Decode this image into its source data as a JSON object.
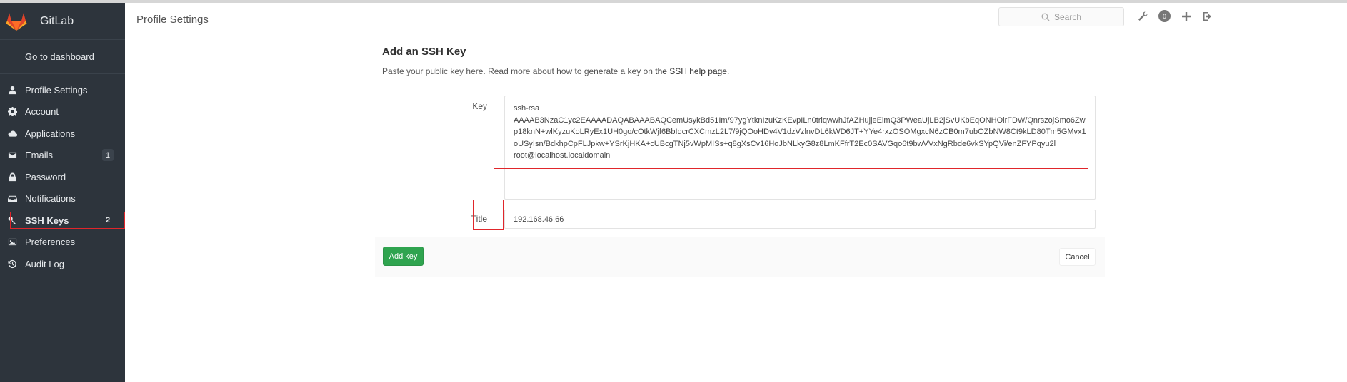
{
  "app": {
    "name": "GitLab"
  },
  "sidebar": {
    "goto": "Go to dashboard",
    "items": [
      {
        "label": "Profile Settings",
        "icon": "user-icon"
      },
      {
        "label": "Account",
        "icon": "gear-icon"
      },
      {
        "label": "Applications",
        "icon": "cloud-icon"
      },
      {
        "label": "Emails",
        "icon": "envelope-icon",
        "badge": "1"
      },
      {
        "label": "Password",
        "icon": "lock-icon"
      },
      {
        "label": "Notifications",
        "icon": "inbox-icon"
      },
      {
        "label": "SSH Keys",
        "icon": "key-icon",
        "badge": "2",
        "active": true
      },
      {
        "label": "Preferences",
        "icon": "image-icon"
      },
      {
        "label": "Audit Log",
        "icon": "history-icon"
      }
    ]
  },
  "header": {
    "title": "Profile Settings",
    "search_placeholder": "Search",
    "todo_count": "0"
  },
  "form": {
    "heading": "Add an SSH Key",
    "desc_prefix": "Paste your public key here. Read more about how to generate a key on ",
    "desc_link": "the SSH help page",
    "desc_suffix": ".",
    "key_label": "Key",
    "key_value": "ssh-rsa\nAAAAB3NzaC1yc2EAAAADAQABAAABAQCemUsykBd51Im/97ygYtknIzuKzKEvpILn0trlqwwhJfAZHujjeEimQ3PWeaUjLB2jSvUKbEqONHOirFDW/QnrszojSmo6Zwp18knN+wlKyzuKoLRyEx1UH0go/cOtkWjf6BbIdcrCXCmzL2L7/9jQOoHDv4V1dzVzlnvDL6kWD6JT+YYe4rxzOSOMgxcN6zCB0m7ubOZbNW8Ct9kLD80Tm5GMvx1oUSyIsn/BdkhpCpFLJpkw+YSrKjHKA+cUBcgTNj5vWpMISs+q8gXsCv16HoJbNLkyG8z8LmKFfrT2Ec0SAVGqo6t9bwVVxNgRbde6vkSYpQVi/enZFYPqyu2l\nroot@localhost.localdomain",
    "title_label": "Title",
    "title_value": "192.168.46.66",
    "add_button": "Add key",
    "cancel_button": "Cancel"
  },
  "colors": {
    "sidebar_bg": "#2d343c",
    "accent_green": "#2fa44f",
    "highlight_red": "#e0262b"
  }
}
